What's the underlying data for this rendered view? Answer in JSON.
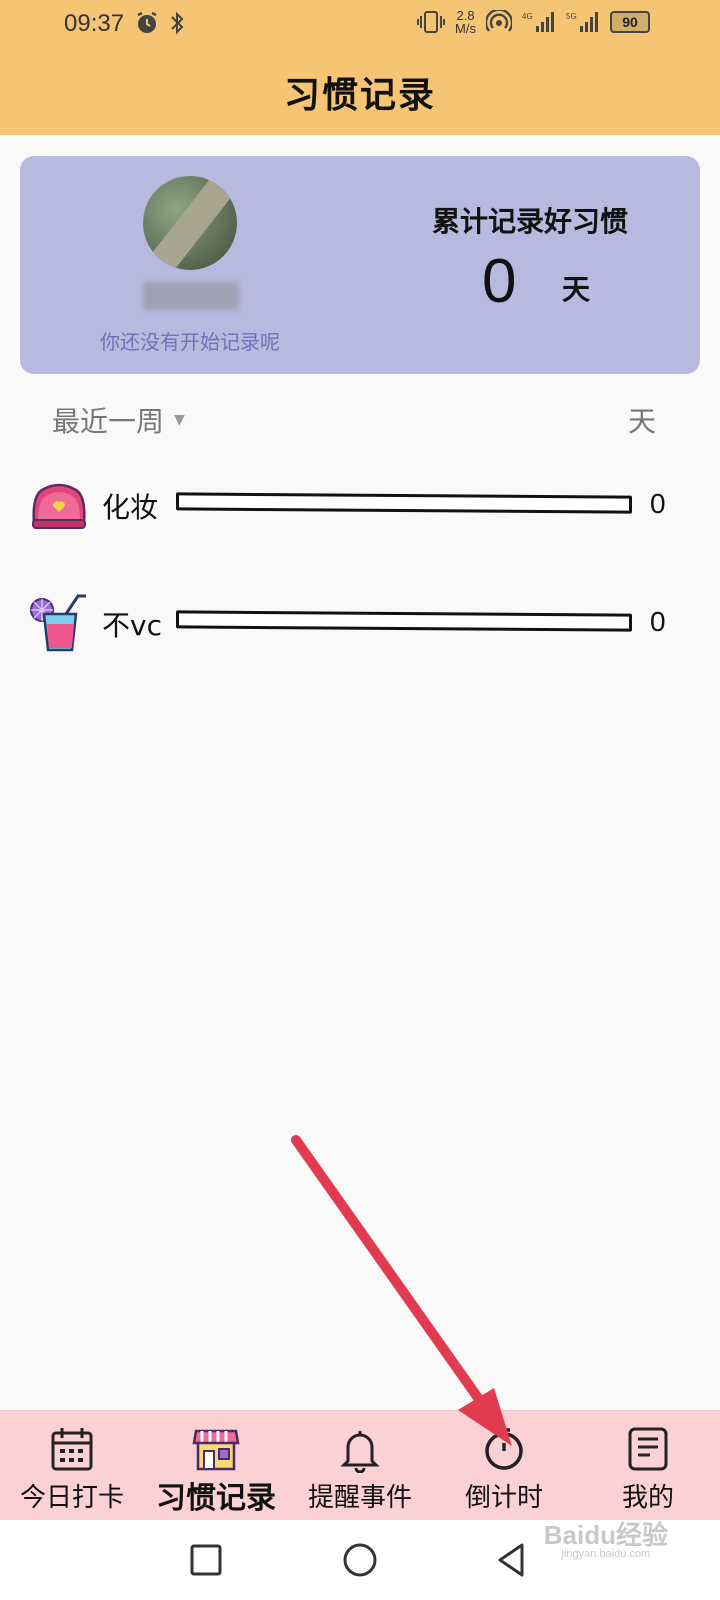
{
  "status_bar": {
    "time": "09:37",
    "net_speed_value": "2.8",
    "net_speed_unit": "M/s",
    "signal_1": "4G",
    "signal_2": "5G",
    "battery": "90"
  },
  "header": {
    "title": "习惯记录"
  },
  "summary": {
    "empty_hint": "你还没有开始记录呢",
    "total_label": "累计记录好习惯",
    "total_value": "0",
    "total_unit": "天"
  },
  "period": {
    "selected": "最近一周",
    "unit": "天"
  },
  "habits": [
    {
      "name": "化妆",
      "count": "0",
      "progress": 0,
      "icon": "makeup-bag-icon"
    },
    {
      "name": "不vc",
      "count": "0",
      "progress": 0,
      "icon": "drink-cup-icon"
    }
  ],
  "nav": [
    {
      "label": "今日打卡",
      "icon": "calendar-icon"
    },
    {
      "label": "习惯记录",
      "icon": "shop-icon",
      "active": true
    },
    {
      "label": "提醒事件",
      "icon": "bell-icon"
    },
    {
      "label": "倒计时",
      "icon": "timer-icon"
    },
    {
      "label": "我的",
      "icon": "profile-document-icon"
    }
  ],
  "watermark": {
    "brand": "Baidu经验",
    "url": "jingyan.baidu.com"
  },
  "colors": {
    "header_bg": "#f5c574",
    "card_bg": "#b8b9df",
    "nav_bg": "#fbd1d4",
    "arrow": "#e03b4e"
  }
}
